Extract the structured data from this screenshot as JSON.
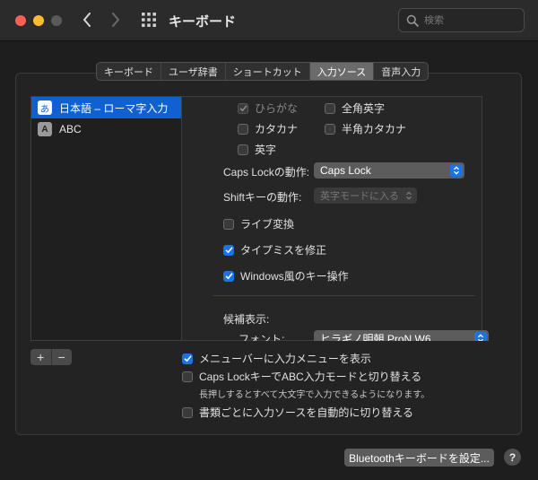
{
  "window": {
    "title": "キーボード"
  },
  "search": {
    "placeholder": "検索"
  },
  "tabs": [
    {
      "label": "キーボード"
    },
    {
      "label": "ユーザ辞書"
    },
    {
      "label": "ショートカット"
    },
    {
      "label": "入力ソース",
      "active": true
    },
    {
      "label": "音声入力"
    }
  ],
  "input_sources": [
    {
      "icon": "あ",
      "label": "日本語 – ローマ字入力",
      "selected": true
    },
    {
      "icon": "A",
      "label": "ABC",
      "selected": false
    }
  ],
  "kana_options": {
    "hiragana": {
      "label": "ひらがな",
      "checked": true,
      "disabled": true
    },
    "zenkaku_eiji": {
      "label": "全角英字",
      "checked": false
    },
    "katakana": {
      "label": "カタカナ",
      "checked": false
    },
    "hankaku_katakana": {
      "label": "半角カタカナ",
      "checked": false
    },
    "eiji": {
      "label": "英字",
      "checked": false
    }
  },
  "capslock_action": {
    "label": "Caps Lockの動作:",
    "value": "Caps Lock"
  },
  "shift_action": {
    "label": "Shiftキーの動作:",
    "value": "英字モードに入る"
  },
  "live_conversion": {
    "label": "ライブ変換",
    "checked": false
  },
  "typo_fix": {
    "label": "タイプミスを修正",
    "checked": true
  },
  "windows_keys": {
    "label": "Windows風のキー操作",
    "checked": true
  },
  "candidates": {
    "heading": "候補表示:",
    "font_label": "フォント:",
    "font_value": "ヒラギノ明朝 ProN W6"
  },
  "list_controls": {
    "add": "+",
    "remove": "−"
  },
  "bottom_options": {
    "menubar": {
      "label": "メニューバーに入力メニューを表示",
      "checked": true
    },
    "capslock_abc": {
      "label": "Caps LockキーでABC入力モードと切り替える",
      "checked": false,
      "note": "長押しするとすべて大文字で入力できるようになります。"
    },
    "per_document": {
      "label": "書類ごとに入力ソースを自動的に切り替える",
      "checked": false
    }
  },
  "bluetooth_button": {
    "label": "Bluetoothキーボードを設定..."
  },
  "help_button": {
    "label": "?"
  },
  "colors": {
    "accent": "#1a73e8",
    "selection": "#0f61d1",
    "close": "#fe5f57",
    "minimize": "#febc2e"
  }
}
